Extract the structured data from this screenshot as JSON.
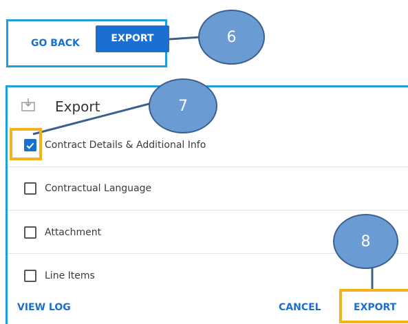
{
  "toolbar": {
    "go_back_label": "GO BACK",
    "export_label": "EXPORT"
  },
  "callouts": [
    "6",
    "7",
    "8"
  ],
  "dialog": {
    "title": "Export",
    "options": [
      {
        "label": "Contract Details & Additional Info",
        "checked": true
      },
      {
        "label": "Contractual Language",
        "checked": false
      },
      {
        "label": "Attachment",
        "checked": false
      },
      {
        "label": "Line Items",
        "checked": false
      }
    ],
    "view_log_label": "VIEW LOG",
    "cancel_label": "CANCEL",
    "export_label": "EXPORT"
  },
  "colors": {
    "accent": "#1a6fd1",
    "frame": "#1ea0e0",
    "highlight": "#f3b21c",
    "bubble": "#6a9bd3"
  }
}
